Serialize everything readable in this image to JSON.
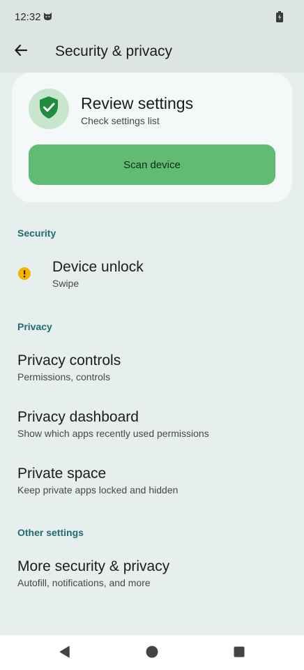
{
  "status_bar": {
    "time": "12:32",
    "notification_icon": "cat-face-icon",
    "battery_icon": "battery-charging-icon"
  },
  "app_bar": {
    "back_icon": "arrow-back-icon",
    "title": "Security & privacy"
  },
  "review_card": {
    "icon": "shield-check-icon",
    "title": "Review settings",
    "subtitle": "Check settings list",
    "scan_button_label": "Scan device"
  },
  "sections": {
    "security": {
      "header": "Security",
      "device_unlock": {
        "title": "Device unlock",
        "summary": "Swipe",
        "icon": "warning-icon"
      }
    },
    "privacy": {
      "header": "Privacy",
      "privacy_controls": {
        "title": "Privacy controls",
        "summary": "Permissions, controls"
      },
      "privacy_dashboard": {
        "title": "Privacy dashboard",
        "summary": "Show which apps recently used permissions"
      },
      "private_space": {
        "title": "Private space",
        "summary": "Keep private apps locked and hidden"
      }
    },
    "other": {
      "header": "Other settings",
      "more_security": {
        "title": "More security & privacy",
        "summary": "Autofill, notifications, and more"
      }
    }
  },
  "nav_bar": {
    "back": "triangle-back-icon",
    "home": "circle-home-icon",
    "recents": "square-recents-icon"
  },
  "colors": {
    "background": "#e7eeee",
    "card": "#f4f8f8",
    "accent_green": "#62bb73",
    "shield_green": "#1e8e3e",
    "section_header": "#1f6b70",
    "warning": "#f4b400"
  }
}
